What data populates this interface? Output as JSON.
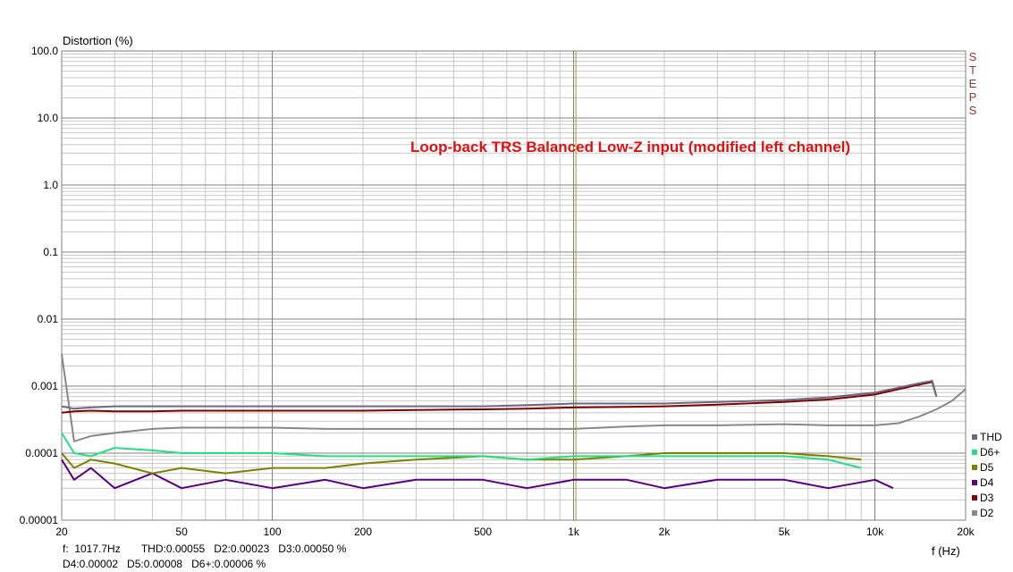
{
  "chart_data": {
    "type": "line",
    "title": "Loop-back TRS Balanced Low-Z input (modified left channel)",
    "title_color": "#e01010",
    "ylabel": "Distortion (%)",
    "xlabel": "f (Hz)",
    "side_label": "STEPS",
    "side_label_color": "#8a3a2a",
    "x_scale": "log",
    "y_scale": "log",
    "xlim": [
      20,
      20000
    ],
    "ylim": [
      1e-05,
      100
    ],
    "x_ticks": [
      {
        "value": 20,
        "label": "20"
      },
      {
        "value": 50,
        "label": "50"
      },
      {
        "value": 100,
        "label": "100"
      },
      {
        "value": 200,
        "label": "200"
      },
      {
        "value": 500,
        "label": "500"
      },
      {
        "value": 1000,
        "label": "1k"
      },
      {
        "value": 2000,
        "label": "2k"
      },
      {
        "value": 5000,
        "label": "5k"
      },
      {
        "value": 10000,
        "label": "10k"
      },
      {
        "value": 20000,
        "label": "20k"
      }
    ],
    "y_ticks": [
      {
        "value": 100,
        "label": "100.0"
      },
      {
        "value": 10,
        "label": "10.0"
      },
      {
        "value": 1,
        "label": "1.0"
      },
      {
        "value": 0.1,
        "label": "0.1"
      },
      {
        "value": 0.01,
        "label": "0.01"
      },
      {
        "value": 0.001,
        "label": "0.001"
      },
      {
        "value": 0.0001,
        "label": "0.0001"
      },
      {
        "value": 1e-05,
        "label": "0.00001"
      }
    ],
    "grid": true,
    "cursor_x": 1017.7,
    "cursor_color": "#a8a020",
    "legend_position": "bottom-right",
    "series": [
      {
        "name": "THD",
        "color": "#6a6a80",
        "x": [
          20,
          22,
          25,
          30,
          40,
          50,
          70,
          100,
          150,
          200,
          300,
          500,
          700,
          1000,
          1500,
          2000,
          3000,
          5000,
          7000,
          10000,
          12000,
          14000,
          15500,
          16000
        ],
        "y": [
          0.0005,
          0.00046,
          0.00048,
          0.0005,
          0.0005,
          0.0005,
          0.0005,
          0.0005,
          0.0005,
          0.0005,
          0.0005,
          0.0005,
          0.00052,
          0.00055,
          0.00055,
          0.00055,
          0.00058,
          0.00062,
          0.00068,
          0.0008,
          0.00095,
          0.0011,
          0.0012,
          0.0007
        ]
      },
      {
        "name": "D6+",
        "color": "#20e080",
        "x": [
          20,
          22,
          25,
          30,
          40,
          50,
          70,
          100,
          150,
          200,
          300,
          500,
          700,
          1000,
          1500,
          2000,
          3000,
          5000,
          7000,
          9000
        ],
        "y": [
          0.0002,
          0.0001,
          9e-05,
          0.00012,
          0.00011,
          0.0001,
          0.0001,
          0.0001,
          9e-05,
          9e-05,
          9e-05,
          9e-05,
          8e-05,
          9e-05,
          9e-05,
          9e-05,
          9e-05,
          9e-05,
          8e-05,
          6e-05
        ]
      },
      {
        "name": "D5",
        "color": "#808000",
        "x": [
          20,
          22,
          25,
          30,
          40,
          50,
          70,
          100,
          150,
          200,
          300,
          500,
          700,
          1000,
          1500,
          2000,
          3000,
          5000,
          7000,
          9000
        ],
        "y": [
          0.0001,
          6e-05,
          8e-05,
          7e-05,
          5e-05,
          6e-05,
          5e-05,
          6e-05,
          6e-05,
          7e-05,
          8e-05,
          9e-05,
          8e-05,
          8e-05,
          9e-05,
          0.0001,
          0.0001,
          0.0001,
          9e-05,
          8e-05
        ]
      },
      {
        "name": "D4",
        "color": "#5a0080",
        "x": [
          20,
          22,
          25,
          30,
          40,
          50,
          70,
          100,
          150,
          200,
          300,
          500,
          700,
          1000,
          1500,
          2000,
          3000,
          5000,
          7000,
          10000,
          11500
        ],
        "y": [
          8e-05,
          4e-05,
          6e-05,
          3e-05,
          5e-05,
          3e-05,
          4e-05,
          3e-05,
          4e-05,
          3e-05,
          4e-05,
          4e-05,
          3e-05,
          4e-05,
          4e-05,
          3e-05,
          4e-05,
          4e-05,
          3e-05,
          4e-05,
          3e-05
        ]
      },
      {
        "name": "D3",
        "color": "#800000",
        "x": [
          20,
          22,
          25,
          30,
          40,
          50,
          70,
          100,
          150,
          200,
          300,
          500,
          700,
          1000,
          1500,
          2000,
          3000,
          5000,
          7000,
          10000,
          12000,
          14000,
          15500,
          16000
        ],
        "y": [
          0.0004,
          0.00042,
          0.00043,
          0.00042,
          0.00042,
          0.00043,
          0.00043,
          0.00043,
          0.00043,
          0.00043,
          0.00044,
          0.00045,
          0.00046,
          0.00048,
          0.00049,
          0.0005,
          0.00053,
          0.00058,
          0.00063,
          0.00075,
          0.0009,
          0.00105,
          0.00115,
          0.0007
        ]
      },
      {
        "name": "D2",
        "color": "#888888",
        "x": [
          20,
          22,
          25,
          30,
          40,
          50,
          70,
          100,
          150,
          200,
          300,
          500,
          700,
          1000,
          1500,
          2000,
          3000,
          5000,
          7000,
          10000,
          12000,
          14000,
          16000,
          18000,
          20000
        ],
        "y": [
          0.003,
          0.00015,
          0.00018,
          0.0002,
          0.00023,
          0.00024,
          0.00024,
          0.00024,
          0.00023,
          0.00023,
          0.00023,
          0.00023,
          0.00023,
          0.00023,
          0.00025,
          0.00026,
          0.00026,
          0.00027,
          0.00026,
          0.00026,
          0.00028,
          0.00035,
          0.00045,
          0.0006,
          0.0009
        ]
      }
    ]
  },
  "status": {
    "line1": "f:  1017.7Hz       THD:0.00055   D2:0.00023   D3:0.00050 %",
    "line2": "D4:0.00002   D5:0.00008   D6+:0.00006 %"
  }
}
